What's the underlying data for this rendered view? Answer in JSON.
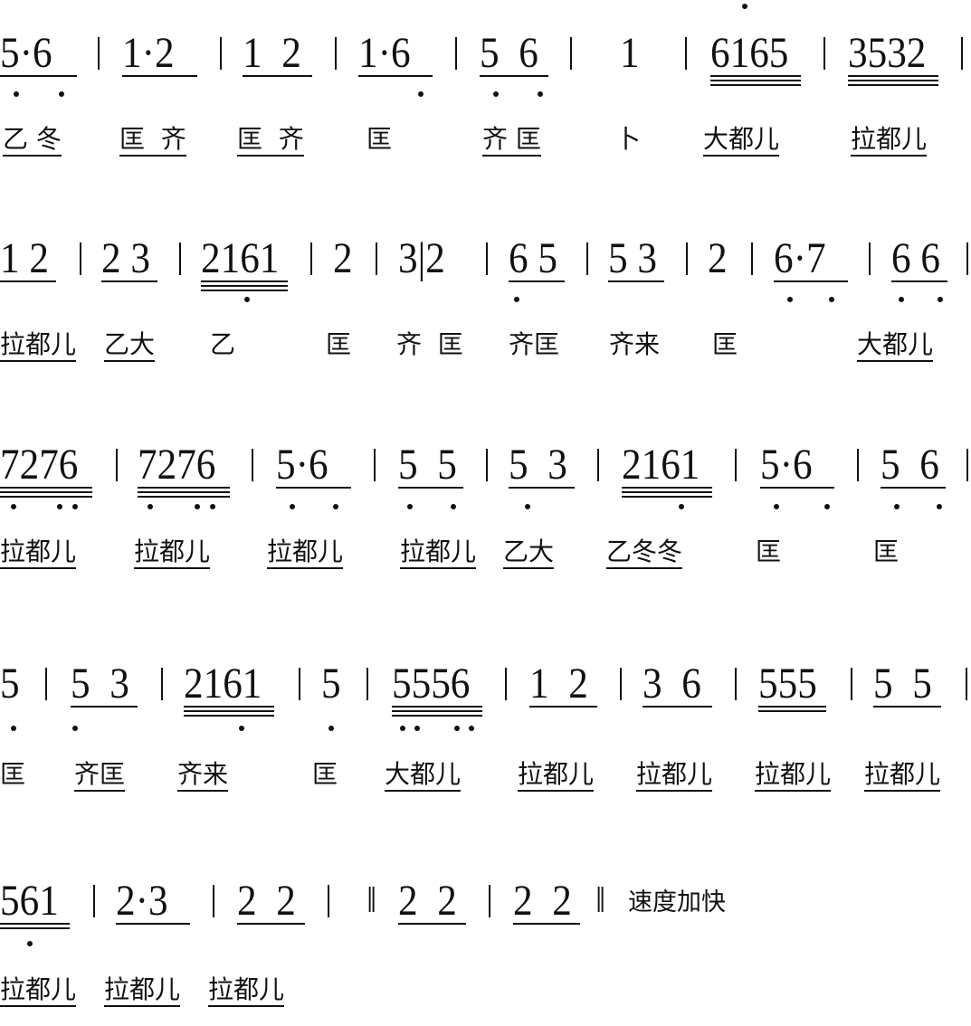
{
  "rows": [
    {
      "measures": [
        "5·6",
        "1·2",
        "1  2",
        "1·6",
        "5  6",
        "1",
        "6165",
        "3532"
      ],
      "lyrics": [
        "乙 冬",
        "匡  齐",
        "匡  齐",
        "匡",
        "齐 匡",
        "卜",
        "大都儿",
        "拉都儿"
      ]
    },
    {
      "measures": [
        "1 2",
        "2 3",
        "2161",
        "2",
        "3|2",
        "6 5",
        "5 3",
        "2",
        "6·7",
        "6 6"
      ],
      "lyrics": [
        "拉都儿",
        "乙大",
        "乙",
        "匡",
        "齐  匡",
        "齐匡",
        "齐来",
        "匡",
        "大都儿"
      ]
    },
    {
      "measures": [
        "7276",
        "7276",
        "5·6",
        "5  5",
        "5  3",
        "2161",
        "5·6",
        "5  6"
      ],
      "lyrics": [
        "拉都儿",
        "拉都儿",
        "拉都儿",
        "拉都儿",
        "乙大",
        "乙冬冬",
        "匡",
        "匡"
      ]
    },
    {
      "measures": [
        "5",
        "5  3",
        "2161",
        "5",
        "5556",
        "1  2",
        "3  6",
        "555",
        "5  5"
      ],
      "lyrics": [
        "匡",
        "齐匡",
        "齐来",
        "匡",
        "大都儿",
        "拉都儿",
        "拉都儿",
        "拉都儿",
        "拉都儿"
      ]
    },
    {
      "measures": [
        "561",
        "2·3",
        "2  2",
        "2  2",
        "2  2"
      ],
      "lyrics": [
        "拉都儿",
        "拉都儿",
        "拉都儿"
      ]
    }
  ],
  "repeat_sign": "‖",
  "tempo_marking": "速度加快"
}
